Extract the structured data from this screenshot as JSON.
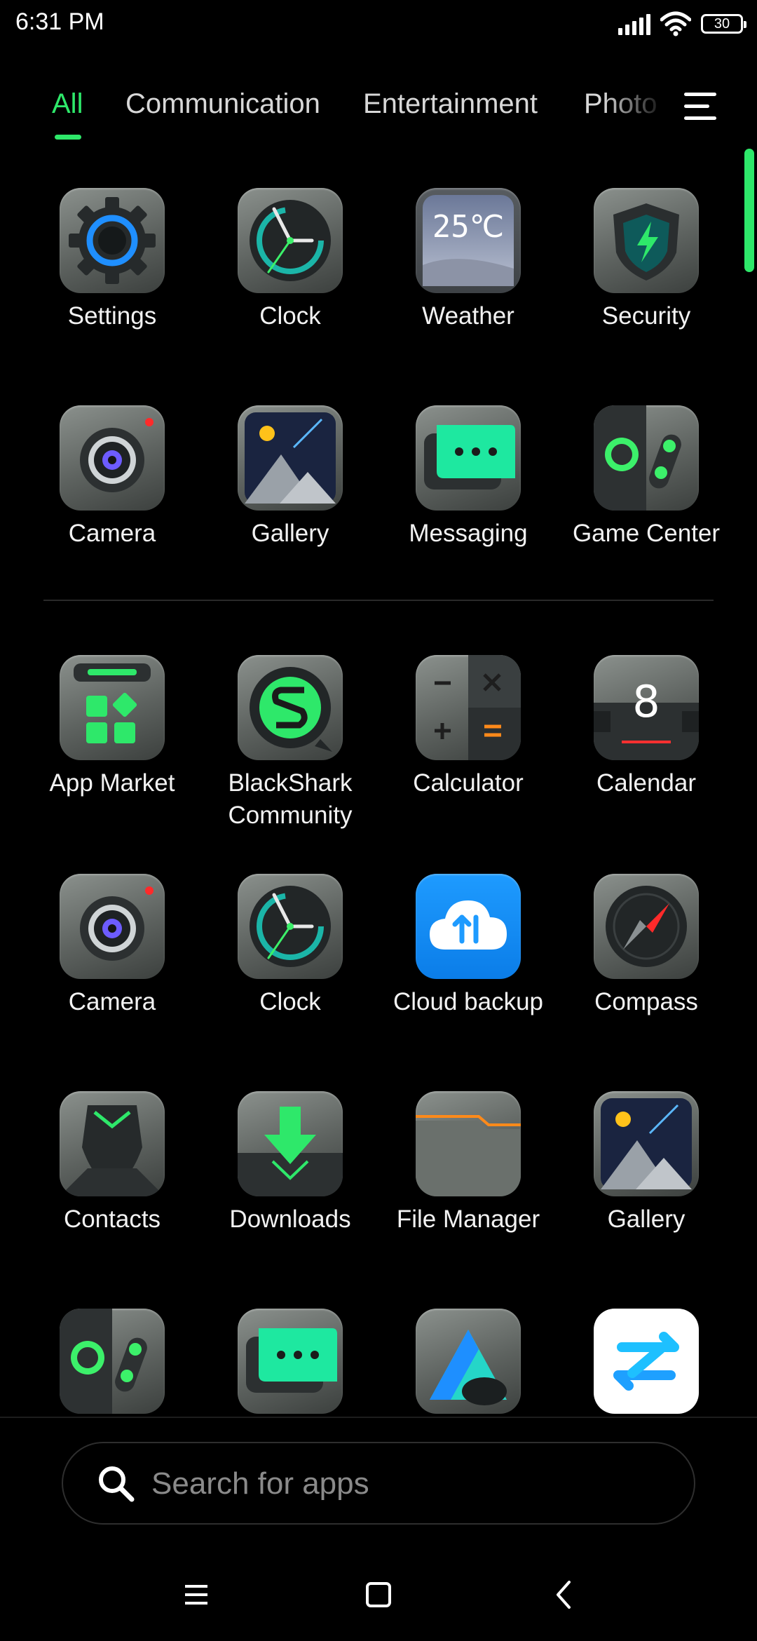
{
  "status_bar": {
    "time": "6:31 PM",
    "battery": "30"
  },
  "tabs": [
    {
      "label": "All",
      "active": true
    },
    {
      "label": "Communication",
      "active": false
    },
    {
      "label": "Entertainment",
      "active": false
    },
    {
      "label": "Photo",
      "active": false
    }
  ],
  "apps": [
    {
      "label": "Settings",
      "icon": "settings-icon"
    },
    {
      "label": "Clock",
      "icon": "clock-icon"
    },
    {
      "label": "Weather",
      "icon": "weather-icon",
      "badge_text": "25℃"
    },
    {
      "label": "Security",
      "icon": "security-icon"
    },
    {
      "label": "Camera",
      "icon": "camera-icon"
    },
    {
      "label": "Gallery",
      "icon": "gallery-icon"
    },
    {
      "label": "Messaging",
      "icon": "messaging-icon"
    },
    {
      "label": "Game Center",
      "icon": "game-center-icon"
    },
    {
      "label": "App Market",
      "icon": "app-market-icon"
    },
    {
      "label": "BlackShark Community",
      "icon": "blackshark-community-icon"
    },
    {
      "label": "Calculator",
      "icon": "calculator-icon"
    },
    {
      "label": "Calendar",
      "icon": "calendar-icon",
      "badge_text": "8"
    },
    {
      "label": "Camera",
      "icon": "camera-icon"
    },
    {
      "label": "Clock",
      "icon": "clock-icon"
    },
    {
      "label": "Cloud backup",
      "icon": "cloud-backup-icon"
    },
    {
      "label": "Compass",
      "icon": "compass-icon"
    },
    {
      "label": "Contacts",
      "icon": "contacts-icon"
    },
    {
      "label": "Downloads",
      "icon": "downloads-icon"
    },
    {
      "label": "File Manager",
      "icon": "file-manager-icon"
    },
    {
      "label": "Gallery",
      "icon": "gallery-icon"
    },
    {
      "label": "",
      "icon": "game-center-icon"
    },
    {
      "label": "",
      "icon": "messaging-icon"
    },
    {
      "label": "",
      "icon": "mountain-a-icon"
    },
    {
      "label": "",
      "icon": "transfer-icon"
    }
  ],
  "search": {
    "placeholder": "Search for apps"
  },
  "colors": {
    "accent": "#2ee86a",
    "background": "#000000"
  }
}
